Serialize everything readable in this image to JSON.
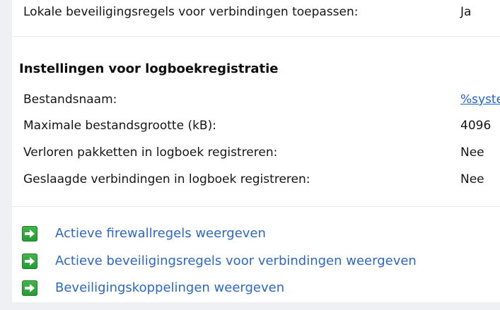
{
  "top_setting": {
    "label": "Lokale beveiligingsregels voor verbindingen toepassen:",
    "value": "Ja"
  },
  "logging_section": {
    "title": "Instellingen voor logboekregistratie",
    "rows": [
      {
        "label": "Bestandsnaam:",
        "value": "%syste",
        "is_link": true
      },
      {
        "label": "Maximale bestandsgrootte (kB):",
        "value": "4096",
        "is_link": false
      },
      {
        "label": "Verloren pakketten in logboek registreren:",
        "value": "Nee",
        "is_link": false
      },
      {
        "label": "Geslaagde verbindingen in logboek registreren:",
        "value": "Nee",
        "is_link": false
      }
    ]
  },
  "actions": [
    {
      "label": "Actieve firewallregels weergeven",
      "icon": "green-arrow-icon"
    },
    {
      "label": "Actieve beveiligingsregels voor verbindingen weergeven",
      "icon": "green-arrow-icon"
    },
    {
      "label": "Beveiligingskoppelingen weergeven",
      "icon": "green-arrow-icon"
    }
  ],
  "colors": {
    "link": "#2d67c7",
    "icon_green": "#2fa53d",
    "background": "#eef0f3",
    "panel": "#ffffff"
  }
}
